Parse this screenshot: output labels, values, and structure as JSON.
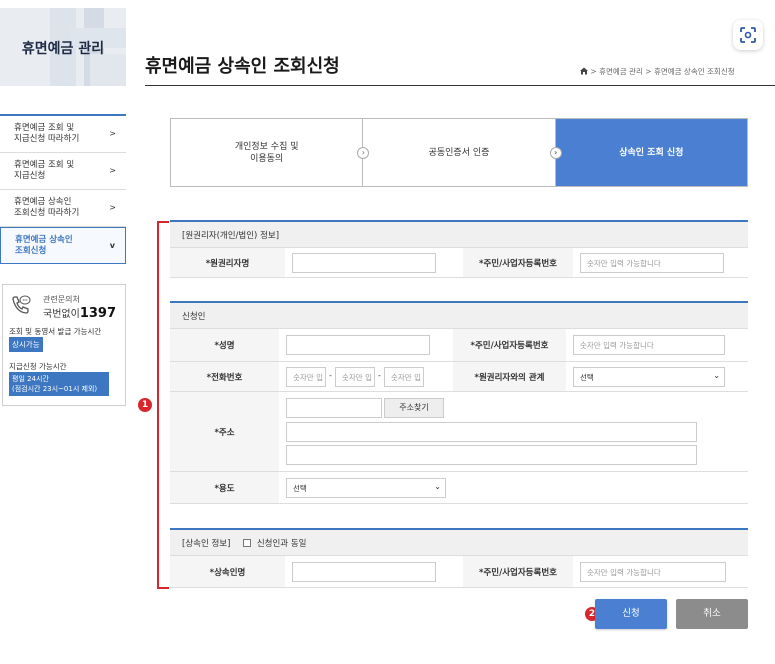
{
  "sidebar": {
    "title": "휴면예금 관리",
    "menu": [
      {
        "label_1": "휴면예금 조회 및",
        "label_2": "지급신청 따라하기",
        "chevron": ">"
      },
      {
        "label_1": "휴면예금 조회 및",
        "label_2": "지급신청",
        "chevron": ">"
      },
      {
        "label_1": "휴면예금 상속인",
        "label_2": "조회신청 따라하기",
        "chevron": ">"
      },
      {
        "label_1": "휴면예금 상속인",
        "label_2": "조회신청",
        "chevron": "v"
      }
    ],
    "contact": {
      "label": "관련문의처",
      "line_prefix": "국번없이",
      "number": "1397",
      "available_label": "조회 및 동영서 발급 가능시간",
      "available_value": "상시가능",
      "apply_label": "지급신청 가능시간",
      "apply_line_1": "평일 24시간",
      "apply_line_2": "(점검시간 23시~01시 제외)"
    }
  },
  "header": {
    "title": "휴면예금 상속인 조회신청",
    "breadcrumb": [
      ">",
      "휴면예금 관리",
      ">",
      "휴면예금 상속인 조회신청"
    ]
  },
  "steps": [
    {
      "label_1": "개인정보 수집 및",
      "label_2": "이용동의"
    },
    {
      "label_1": "공동인증서 인증",
      "label_2": ""
    },
    {
      "label_1": "상속인 조회 신청",
      "label_2": ""
    }
  ],
  "step_arrow": "›",
  "markers": {
    "one": "1",
    "two": "2"
  },
  "original_holder": {
    "heading": "[원권리자(개인/법인) 정보]",
    "name_label": "*원권리자명",
    "name_value": "",
    "id_label": "*주민/사업자등록번호",
    "id_placeholder": "숫자만 입력 가능합니다"
  },
  "applicant": {
    "heading": "신청인",
    "name_label": "*성명",
    "name_value": "",
    "id_label": "*주민/사업자등록번호",
    "id_placeholder": "숫자만 입력 가능합니다",
    "phone_label": "*전화번호",
    "phone_placeholders": [
      "숫자만 입",
      "숫자만 입",
      "숫자만 입"
    ],
    "phone_sep": "-",
    "relation_label": "*원권리자와의 관계",
    "relation_value": "선택",
    "address_label": "*주소",
    "address_search": "주소찾기",
    "purpose_label": "*용도",
    "purpose_value": "선택"
  },
  "heir": {
    "heading": "[상속인 정보]",
    "same_checkbox": "신청인과 동일",
    "name_label": "*상속인명",
    "name_value": "",
    "id_label": "*주민/사업자등록번호",
    "id_placeholder": "숫자만 입력 가능합니다"
  },
  "buttons": {
    "apply": "신청",
    "cancel": "취소"
  },
  "colors": {
    "accent": "#3e77c1",
    "step_active": "#4a7fd1",
    "marker": "#d9262c",
    "cancel": "#8c8c8c"
  }
}
